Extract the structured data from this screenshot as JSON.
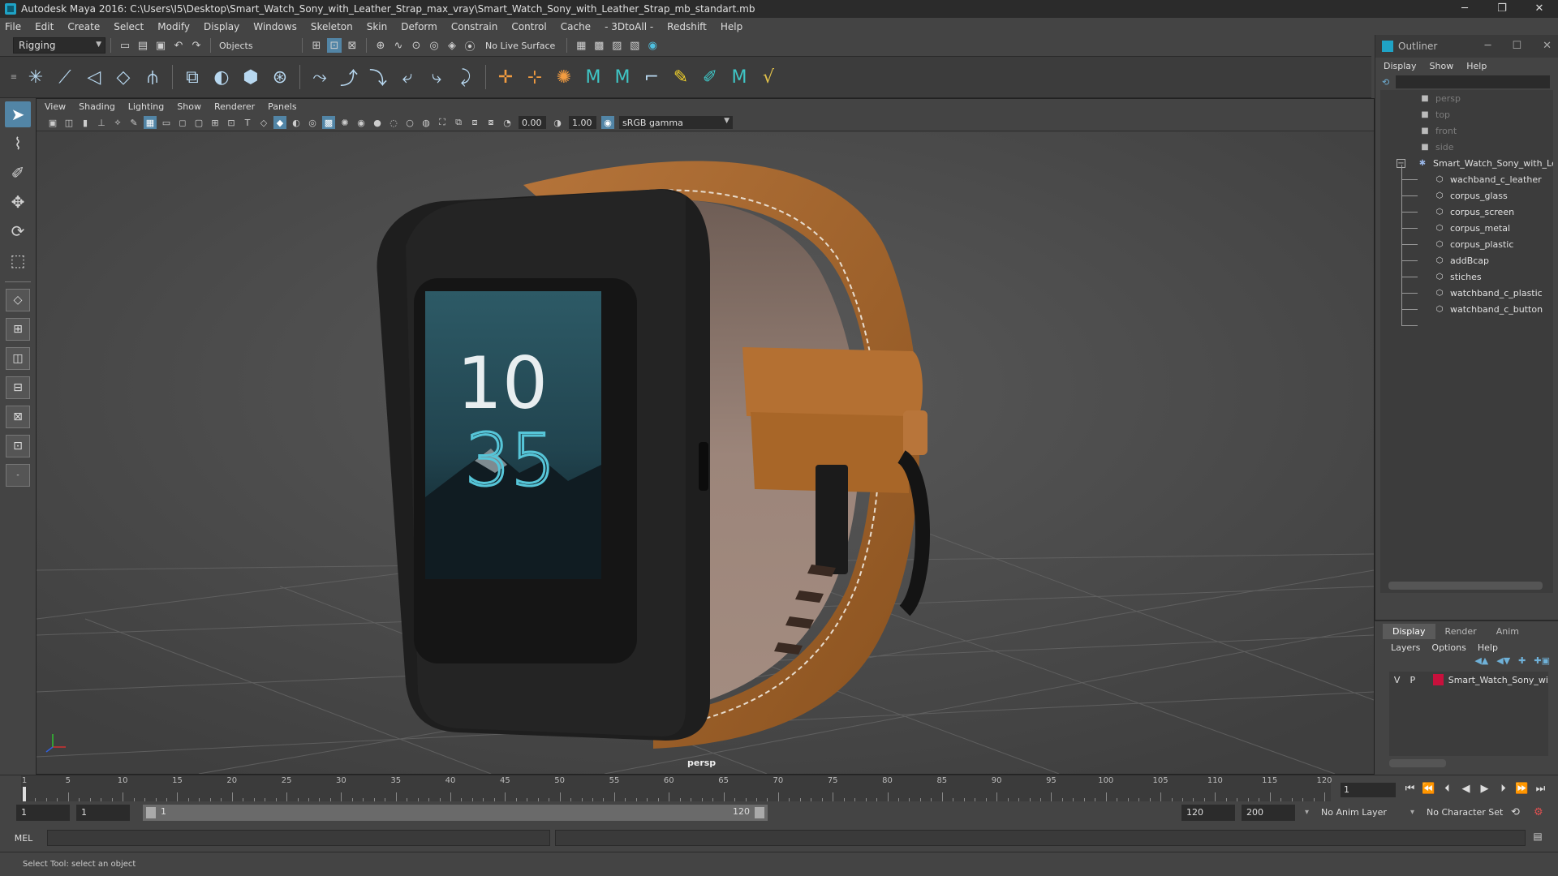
{
  "window": {
    "title": "Autodesk Maya 2016: C:\\Users\\I5\\Desktop\\Smart_Watch_Sony_with_Leather_Strap_max_vray\\Smart_Watch_Sony_with_Leather_Strap_mb_standart.mb",
    "minimize": "─",
    "restore": "❐",
    "close": "✕"
  },
  "menubar": [
    "File",
    "Edit",
    "Create",
    "Select",
    "Modify",
    "Display",
    "Windows",
    "Skeleton",
    "Skin",
    "Deform",
    "Constrain",
    "Control",
    "Cache",
    "- 3DtoAll -",
    "Redshift",
    "Help"
  ],
  "statusline": {
    "mode": "Rigging",
    "objects": "Objects",
    "live_surface": "No Live Surface"
  },
  "viewport": {
    "menu": [
      "View",
      "Shading",
      "Lighting",
      "Show",
      "Renderer",
      "Panels"
    ],
    "exposure": "0.00",
    "gamma_value": "1.00",
    "color_space": "sRGB gamma",
    "camera_label": "persp",
    "watch_screen": {
      "hour": "10",
      "minute": "35"
    }
  },
  "outliner": {
    "title": "Outliner",
    "menu": [
      "Display",
      "Show",
      "Help"
    ],
    "cameras": [
      "persp",
      "top",
      "front",
      "side"
    ],
    "group": "Smart_Watch_Sony_with_Lea",
    "children": [
      "wachband_c_leather",
      "corpus_glass",
      "corpus_screen",
      "corpus_metal",
      "corpus_plastic",
      "addBcap",
      "stiches",
      "watchband_c_plastic",
      "watchband_c_button"
    ]
  },
  "layers": {
    "tabs": [
      "Display",
      "Render",
      "Anim"
    ],
    "menu": [
      "Layers",
      "Options",
      "Help"
    ],
    "rows": [
      {
        "v": "V",
        "p": "P",
        "name": "Smart_Watch_Sony_wi",
        "color": "#c8103c"
      }
    ]
  },
  "timeline": {
    "ticks": [
      1,
      5,
      10,
      15,
      20,
      25,
      30,
      35,
      40,
      45,
      50,
      55,
      60,
      65,
      70,
      75,
      80,
      85,
      90,
      95,
      100,
      105,
      110,
      115,
      120
    ],
    "labels": [
      "5",
      "10",
      "15",
      "20",
      "25",
      "30",
      "35",
      "40",
      "45",
      "50",
      "55",
      "60",
      "65",
      "70",
      "75",
      "80",
      "85",
      "90",
      "95",
      "100",
      "105",
      "110",
      "115",
      "120"
    ],
    "first_label": "1",
    "current_frame": "1"
  },
  "range": {
    "start": "1",
    "playback_start": "1",
    "slider_start": "1",
    "slider_end": "120",
    "playback_end": "120",
    "end": "200",
    "anim_layer": "No Anim Layer",
    "character_set": "No Character Set"
  },
  "command": {
    "lang": "MEL"
  },
  "help_line": "Select Tool: select an object"
}
